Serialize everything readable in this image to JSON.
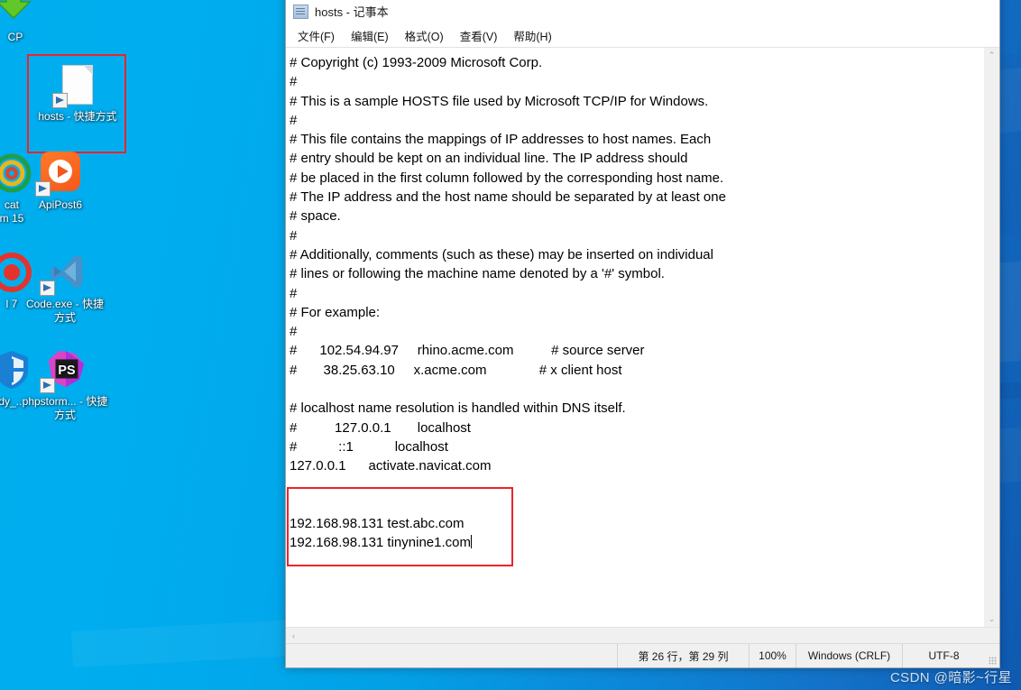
{
  "desktop": {
    "wallpaper_color_left": "#00aeef",
    "wallpaper_color_right": "#0f59b0",
    "watermark": "CSDN @暗影~行星",
    "icons": [
      {
        "name": "cp-download",
        "label": "CP",
        "glyph": "download-arrow-icon"
      },
      {
        "name": "hosts-shortcut",
        "label": "hosts - 快捷方式",
        "glyph": "document-shortcut-icon",
        "selected": true
      },
      {
        "name": "navicat",
        "label": "cat\nm 15",
        "glyph": "navicat-icon"
      },
      {
        "name": "apipost6",
        "label": "ApiPost6",
        "glyph": "apipost-icon"
      },
      {
        "name": "idea",
        "label": "l 7",
        "glyph": "idea-icon"
      },
      {
        "name": "vscode-shortcut",
        "label": "Code.exe - 快捷方式",
        "glyph": "vscode-icon"
      },
      {
        "name": "defender",
        "label": "dy_...",
        "glyph": "shield-icon"
      },
      {
        "name": "phpstorm-shortcut",
        "label": "phpstorm... - 快捷方式",
        "glyph": "phpstorm-icon"
      }
    ],
    "selection_color": "#e8262c"
  },
  "window": {
    "title": "hosts - 记事本",
    "icon": "notepad-icon",
    "controls": {
      "minimize": "—",
      "maximize": "□",
      "close": "✕"
    },
    "menu": [
      {
        "name": "file",
        "label": "文件(F)"
      },
      {
        "name": "edit",
        "label": "编辑(E)"
      },
      {
        "name": "format",
        "label": "格式(O)"
      },
      {
        "name": "view",
        "label": "查看(V)"
      },
      {
        "name": "help",
        "label": "帮助(H)"
      }
    ],
    "editor": {
      "lines": [
        "# Copyright (c) 1993-2009 Microsoft Corp.",
        "#",
        "# This is a sample HOSTS file used by Microsoft TCP/IP for Windows.",
        "#",
        "# This file contains the mappings of IP addresses to host names. Each",
        "# entry should be kept on an individual line. The IP address should",
        "# be placed in the first column followed by the corresponding host name.",
        "# The IP address and the host name should be separated by at least one",
        "# space.",
        "#",
        "# Additionally, comments (such as these) may be inserted on individual",
        "# lines or following the machine name denoted by a '#' symbol.",
        "#",
        "# For example:",
        "#",
        "#      102.54.94.97     rhino.acme.com          # source server",
        "#       38.25.63.10     x.acme.com              # x client host",
        "",
        "# localhost name resolution is handled within DNS itself.",
        "#          127.0.0.1       localhost",
        "#           ::1           localhost",
        "127.0.0.1      activate.navicat.com",
        "",
        "",
        "192.168.98.131 test.abc.com",
        "192.168.98.131 tinynine1.com"
      ],
      "highlight_color": "#e8262c",
      "caret_line_index": 25
    },
    "scrollbars": {
      "vertical_up": "⌃",
      "vertical_down": "⌄",
      "horizontal_left": "‹",
      "horizontal_right": "›"
    },
    "statusbar": {
      "position": "第 26 行，第 29 列",
      "zoom": "100%",
      "line_ending": "Windows (CRLF)",
      "encoding": "UTF-8"
    }
  }
}
